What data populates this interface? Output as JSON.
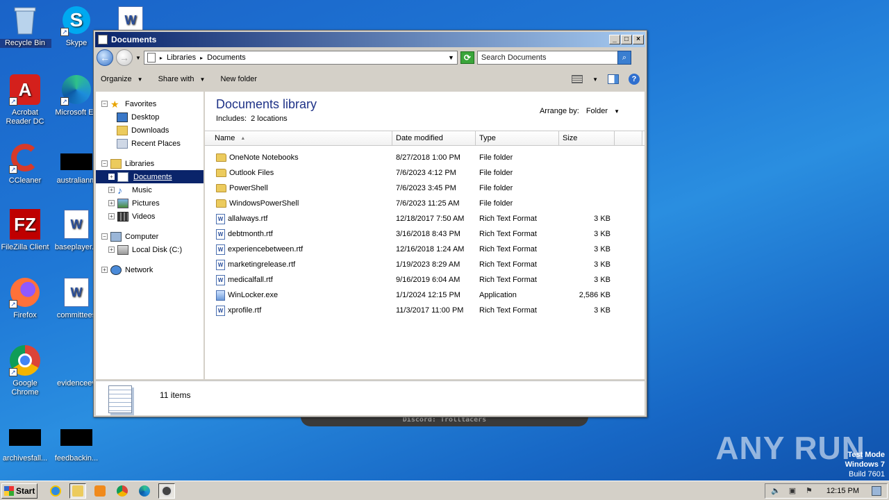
{
  "desktop": {
    "icons": [
      {
        "label": "Recycle Bin"
      },
      {
        "label": "Skype"
      },
      {
        "label": "Acrobat Reader DC"
      },
      {
        "label": "Microsoft Ed"
      },
      {
        "label": "CCleaner"
      },
      {
        "label": "australianm"
      },
      {
        "label": "FileZilla Client"
      },
      {
        "label": "baseplayer..."
      },
      {
        "label": "Firefox"
      },
      {
        "label": "committees"
      },
      {
        "label": "Google Chrome"
      },
      {
        "label": "evidenceev"
      },
      {
        "label": "archivesfall..."
      },
      {
        "label": "feedbackin..."
      }
    ],
    "banner_text": "Discord: Trolltacers",
    "watermark": "ANY RUN",
    "testmode": {
      "line1": "Test Mode",
      "line2": "Windows 7",
      "line3": "Build 7601"
    }
  },
  "window": {
    "title": "Documents",
    "address": {
      "crumb1": "Libraries",
      "crumb2": "Documents"
    },
    "search_placeholder": "Search Documents",
    "toolbar": {
      "organize": "Organize",
      "share": "Share with",
      "new_folder": "New folder"
    },
    "nav": {
      "favorites": "Favorites",
      "desktop": "Desktop",
      "downloads": "Downloads",
      "recent": "Recent Places",
      "libraries": "Libraries",
      "documents": "Documents",
      "music": "Music",
      "pictures": "Pictures",
      "videos": "Videos",
      "computer": "Computer",
      "local_disk": "Local Disk (C:)",
      "network": "Network"
    },
    "library": {
      "title": "Documents library",
      "includes_label": "Includes:",
      "includes_value": "2 locations",
      "arrange_label": "Arrange by:",
      "arrange_value": "Folder"
    },
    "columns": {
      "name": "Name",
      "date": "Date modified",
      "type": "Type",
      "size": "Size"
    },
    "files": [
      {
        "name": "OneNote Notebooks",
        "date": "8/27/2018 1:00 PM",
        "type": "File folder",
        "size": "",
        "kind": "folder"
      },
      {
        "name": "Outlook Files",
        "date": "7/6/2023 4:12 PM",
        "type": "File folder",
        "size": "",
        "kind": "folder"
      },
      {
        "name": "PowerShell",
        "date": "7/6/2023 3:45 PM",
        "type": "File folder",
        "size": "",
        "kind": "folder"
      },
      {
        "name": "WindowsPowerShell",
        "date": "7/6/2023 11:25 AM",
        "type": "File folder",
        "size": "",
        "kind": "folder"
      },
      {
        "name": "allalways.rtf",
        "date": "12/18/2017 7:50 AM",
        "type": "Rich Text Format",
        "size": "3 KB",
        "kind": "doc"
      },
      {
        "name": "debtmonth.rtf",
        "date": "3/16/2018 8:43 PM",
        "type": "Rich Text Format",
        "size": "3 KB",
        "kind": "doc"
      },
      {
        "name": "experiencebetween.rtf",
        "date": "12/16/2018 1:24 AM",
        "type": "Rich Text Format",
        "size": "3 KB",
        "kind": "doc"
      },
      {
        "name": "marketingrelease.rtf",
        "date": "1/19/2023 8:29 AM",
        "type": "Rich Text Format",
        "size": "3 KB",
        "kind": "doc"
      },
      {
        "name": "medicalfall.rtf",
        "date": "9/16/2019 6:04 AM",
        "type": "Rich Text Format",
        "size": "3 KB",
        "kind": "doc"
      },
      {
        "name": "WinLocker.exe",
        "date": "1/1/2024 12:15 PM",
        "type": "Application",
        "size": "2,586 KB",
        "kind": "exe"
      },
      {
        "name": "xprofile.rtf",
        "date": "11/3/2017 11:00 PM",
        "type": "Rich Text Format",
        "size": "3 KB",
        "kind": "doc"
      }
    ],
    "item_count": "11 items"
  },
  "taskbar": {
    "start": "Start",
    "clock": "12:15 PM"
  }
}
